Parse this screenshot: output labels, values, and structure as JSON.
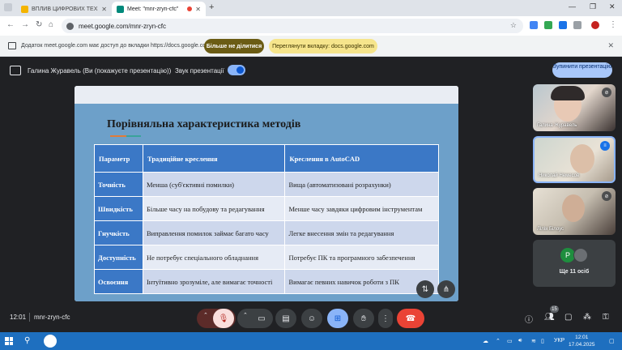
{
  "browser": {
    "tabs": [
      {
        "title": "ВПЛИВ ЦИФРОВИХ ТЕХНОЛ",
        "active": false
      },
      {
        "title": "Meet: \"mnr-zryn-cfc\"",
        "active": true
      }
    ],
    "new_tab": "+",
    "url": "meet.google.com/mnr-zryn-cfc",
    "window_controls": {
      "minimize": "—",
      "restore": "❐",
      "close": "✕"
    }
  },
  "infobar": {
    "message": "Додаток meet.google.com має доступ до вкладки https://docs.google.com",
    "stop_sharing_label": "Більше не ділитися",
    "switch_tab_label": "Переглянути вкладку: docs.google.com"
  },
  "presenting": {
    "presenter": "Галина Журавель (Ви (покажуєте презентацію))",
    "sound_label": "Звук презентації",
    "sound_on": true,
    "stop_button": "Зупинити презентацію"
  },
  "slide": {
    "title": "Порівняльна характеристика методів",
    "headers": [
      "Параметр",
      "Традиційне креслення",
      "Креслення в AutoCAD"
    ],
    "rows": [
      [
        "Точність",
        "Менша (суб'єктивні помилки)",
        "Вища (автоматизовані розрахунки)"
      ],
      [
        "Швидкість",
        "Більше часу на побудову та редагування",
        "Менше часу завдяки цифровим інструментам"
      ],
      [
        "Гнучкість",
        "Виправлення помилок займає багато часу",
        "Легке внесення змін та редагування"
      ],
      [
        "Доступність",
        "Не потребує спеціального обладнання",
        "Потребує ПК та програмного забезпечення"
      ],
      [
        "Освоєння",
        "Інтуїтивно зрозуміле, але вимагає точності",
        "Вимагає певних навичок роботи з ПК"
      ]
    ]
  },
  "participants": [
    {
      "name": "Галина Журавель"
    },
    {
      "name": "Николай Немесов"
    },
    {
      "name": "Лілія Білоус"
    }
  ],
  "others": {
    "initial": "P",
    "label": "Ще 11 осіб"
  },
  "bottombar": {
    "time": "12:01",
    "meeting_code": "mnr-zryn-cfc",
    "participant_count": "15"
  },
  "taskbar": {
    "language": "УКР",
    "time": "12:01",
    "date": "17.04.2025"
  },
  "colors": {
    "meet_bg": "#202124",
    "end_call": "#ea4335",
    "present_active": "#8ab4f8",
    "table_header": "#3b78c6",
    "taskbar": "#1e6fbf"
  }
}
